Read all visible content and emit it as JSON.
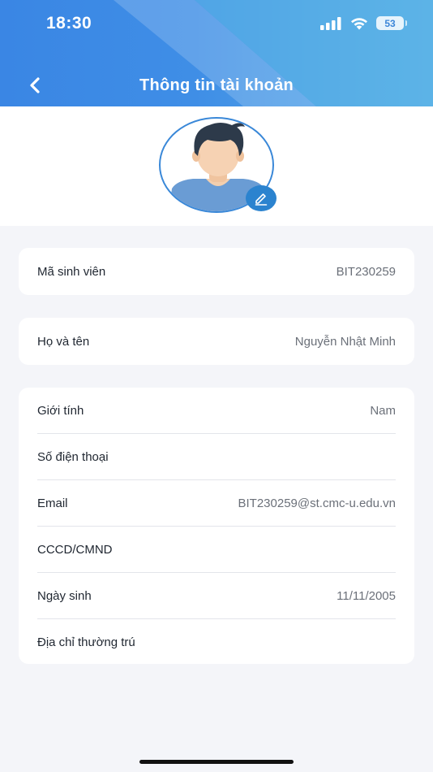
{
  "status_bar": {
    "time": "18:30",
    "battery": "53"
  },
  "header": {
    "title": "Thông tin tài khoản"
  },
  "colors": {
    "accent": "#3a86e4",
    "edit_button": "#2b83cf",
    "background": "#f4f5f9"
  },
  "profile": {
    "student_id": {
      "label": "Mã sinh viên",
      "value": "BIT230259"
    },
    "full_name": {
      "label": "Họ và tên",
      "value": "Nguyễn Nhật Minh"
    },
    "details": [
      {
        "label": "Giới tính",
        "value": "Nam"
      },
      {
        "label": "Số điện thoại",
        "value": ""
      },
      {
        "label": "Email",
        "value": "BIT230259@st.cmc-u.edu.vn"
      },
      {
        "label": "CCCD/CMND",
        "value": ""
      },
      {
        "label": "Ngày sinh",
        "value": "11/11/2005"
      },
      {
        "label": "Địa chỉ thường trú",
        "value": ""
      }
    ]
  },
  "icons": [
    "back-chevron-icon",
    "signal-icon",
    "wifi-icon",
    "battery-icon",
    "avatar-illustration",
    "edit-pencil-icon"
  ]
}
